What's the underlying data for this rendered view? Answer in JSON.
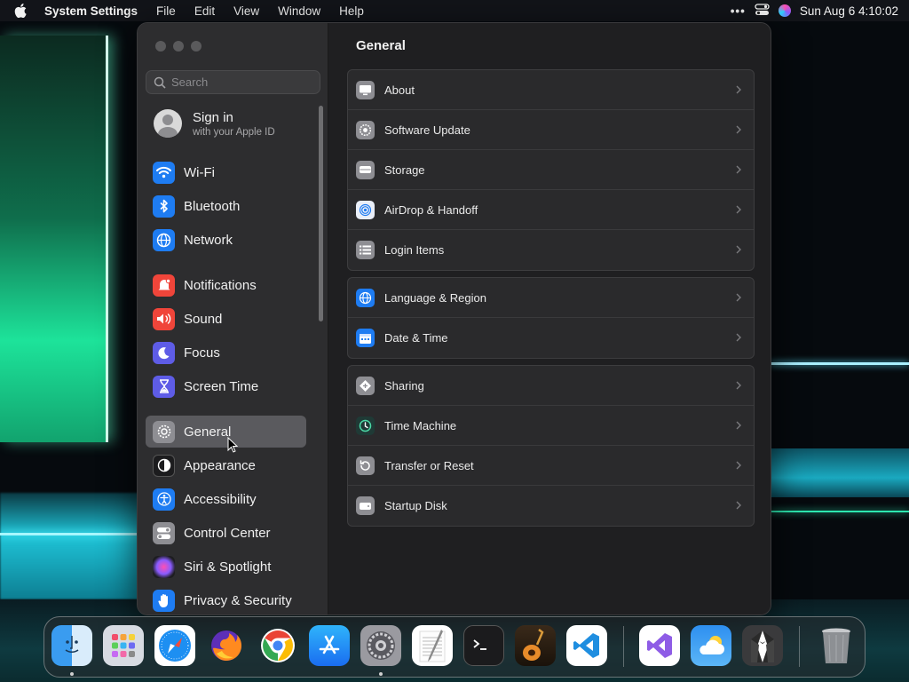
{
  "menubar": {
    "app_name": "System Settings",
    "menus": [
      "File",
      "Edit",
      "View",
      "Window",
      "Help"
    ],
    "more": "•••",
    "datetime": "Sun Aug 6  4:10:02"
  },
  "sidebar": {
    "search_placeholder": "Search",
    "account": {
      "title": "Sign in",
      "subtitle": "with your Apple ID"
    },
    "items": [
      {
        "label": "Wi-Fi",
        "icon": "wifi-icon",
        "color": "#1e7cf2"
      },
      {
        "label": "Bluetooth",
        "icon": "bluetooth-icon",
        "color": "#1e7cf2"
      },
      {
        "label": "Network",
        "icon": "globe-icon",
        "color": "#1e7cf2"
      },
      {
        "label": "Notifications",
        "icon": "bell-icon",
        "color": "#f0453a"
      },
      {
        "label": "Sound",
        "icon": "speaker-icon",
        "color": "#f0453a"
      },
      {
        "label": "Focus",
        "icon": "moon-icon",
        "color": "#5e5ce6"
      },
      {
        "label": "Screen Time",
        "icon": "hourglass-icon",
        "color": "#5e5ce6"
      },
      {
        "label": "General",
        "icon": "gear-icon",
        "color": "#8e8e93",
        "selected": true
      },
      {
        "label": "Appearance",
        "icon": "appearance-icon",
        "color": "#1c1c1e"
      },
      {
        "label": "Accessibility",
        "icon": "accessibility-icon",
        "color": "#1e7cf2"
      },
      {
        "label": "Control Center",
        "icon": "toggles-icon",
        "color": "#8e8e93"
      },
      {
        "label": "Siri & Spotlight",
        "icon": "siri-icon",
        "color": "#2b2b2e"
      },
      {
        "label": "Privacy & Security",
        "icon": "hand-icon",
        "color": "#1e7cf2"
      }
    ]
  },
  "content": {
    "title": "General",
    "groups": [
      [
        {
          "label": "About",
          "icon": "display-icon"
        },
        {
          "label": "Software Update",
          "icon": "gear-update-icon"
        },
        {
          "label": "Storage",
          "icon": "drive-icon"
        },
        {
          "label": "AirDrop & Handoff",
          "icon": "airdrop-icon"
        },
        {
          "label": "Login Items",
          "icon": "list-icon"
        }
      ],
      [
        {
          "label": "Language & Region",
          "icon": "globe-icon"
        },
        {
          "label": "Date & Time",
          "icon": "calendar-icon"
        }
      ],
      [
        {
          "label": "Sharing",
          "icon": "sharing-icon"
        },
        {
          "label": "Time Machine",
          "icon": "time-machine-icon"
        },
        {
          "label": "Transfer or Reset",
          "icon": "reset-icon"
        },
        {
          "label": "Startup Disk",
          "icon": "disk-icon"
        }
      ]
    ]
  },
  "dock": {
    "apps": [
      "Finder",
      "Launchpad",
      "Safari",
      "Firefox",
      "Chrome",
      "App Store",
      "System Settings",
      "TextEdit",
      "Terminal",
      "GarageBand",
      "Visual Studio Code",
      "Visual Studio",
      "Weather",
      "Alfred",
      "Trash"
    ]
  }
}
